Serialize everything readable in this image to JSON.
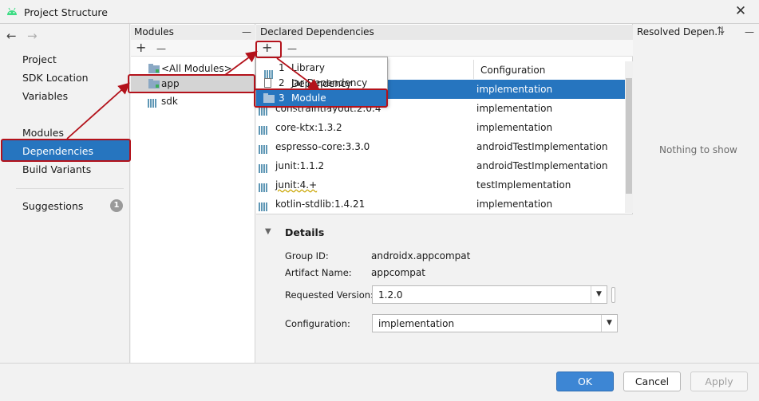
{
  "window": {
    "title": "Project Structure"
  },
  "left_nav": {
    "items": [
      {
        "label": "Project"
      },
      {
        "label": "SDK Location"
      },
      {
        "label": "Variables"
      },
      {
        "label": "Modules"
      },
      {
        "label": "Dependencies",
        "selected": true
      },
      {
        "label": "Build Variants"
      },
      {
        "label": "Suggestions",
        "badge": "1"
      }
    ]
  },
  "modules_pane": {
    "header": "Modules",
    "minimize": "—",
    "add": "+",
    "remove": "—",
    "items": [
      {
        "label": "<All Modules>"
      },
      {
        "label": "app",
        "selected": true
      },
      {
        "label": "sdk"
      }
    ]
  },
  "dependencies_pane": {
    "header": "Declared Dependencies",
    "add": "+",
    "remove": "—",
    "config_header": "Configuration",
    "rows": [
      {
        "name": "appcompat:1.2.0",
        "config": "implementation",
        "selected": true
      },
      {
        "name": "constraintlayout:2.0.4",
        "config": "implementation"
      },
      {
        "name": "core-ktx:1.3.2",
        "config": "implementation"
      },
      {
        "name": "espresso-core:3.3.0",
        "config": "androidTestImplementation"
      },
      {
        "name": "junit:1.1.2",
        "config": "androidTestImplementation"
      },
      {
        "name": "junit:4.+",
        "config": "testImplementation"
      },
      {
        "name": "kotlin-stdlib:1.4.21",
        "config": "implementation"
      }
    ]
  },
  "add_menu": {
    "items": [
      {
        "number": "1",
        "label": "Library Dependency"
      },
      {
        "number": "2",
        "label": "Jar Dependency"
      },
      {
        "number": "3",
        "label": "Module Dependency",
        "selected": true
      }
    ]
  },
  "details": {
    "header": "Details",
    "group_id_label": "Group ID:",
    "group_id": "androidx.appcompat",
    "artifact_label": "Artifact Name:",
    "artifact": "appcompat",
    "version_label": "Requested Version:",
    "version": "1.2.0",
    "config_label": "Configuration:",
    "config": "implementation"
  },
  "resolved_pane": {
    "header": "Resolved Depen...",
    "empty": "Nothing to show"
  },
  "footer": {
    "ok": "OK",
    "cancel": "Cancel",
    "apply": "Apply"
  },
  "colors": {
    "selection": "#2675bf",
    "annotation": "#b3121b",
    "ok_button": "#3d86d4"
  },
  "icons": [
    "android-icon",
    "close-icon",
    "back-arrow-icon",
    "forward-arrow-icon",
    "library-icon",
    "module-folder-icon",
    "collapse-triangle-icon",
    "dropdown-arrow-icon"
  ]
}
